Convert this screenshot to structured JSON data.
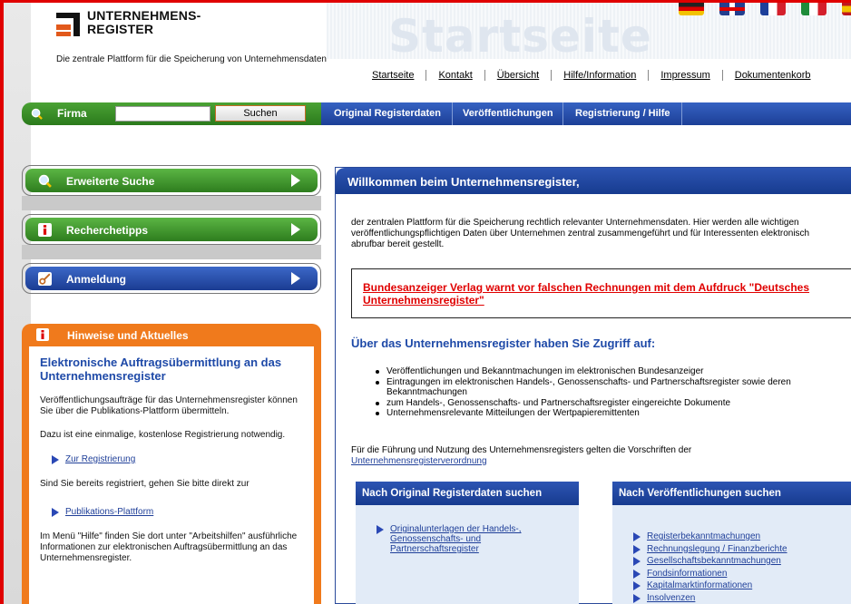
{
  "logo": {
    "line1": "UNTERNEHMENS-",
    "line2": "REGISTER"
  },
  "tagline": "Die zentrale Plattform für die Speicherung von Unternehmensdaten",
  "page_title": "Startseite",
  "top_nav": [
    "Startseite",
    "Kontakt",
    "Übersicht",
    "Hilfe/Information",
    "Impressum",
    "Dokumentenkorb"
  ],
  "search": {
    "label": "Firma",
    "value": "",
    "button": "Suchen"
  },
  "main_nav": [
    "Original Registerdaten",
    "Veröffentlichungen",
    "Registrierung / Hilfe"
  ],
  "sidebar": {
    "items": [
      {
        "label": "Erweiterte Suche"
      },
      {
        "label": "Recherchetipps"
      },
      {
        "label": "Anmeldung"
      }
    ]
  },
  "hinweise": {
    "title": "Hinweise und Aktuelles",
    "heading": "Elektronische Auftragsübermittlung an das Unternehmensregister",
    "p1": "Veröffentlichungsaufträge für das Unternehmensregister können Sie über die Publikations-Plattform übermitteln.",
    "p2": "Dazu ist eine einmalige, kostenlose Registrierung notwendig.",
    "link1": "Zur Registrierung",
    "p3": "Sind Sie bereits registriert, gehen Sie bitte direkt zur",
    "link2": "Publikations-Plattform",
    "p4": "Im Menü \"Hilfe\" finden Sie dort unter \"Arbeitshilfen\" ausführliche Informationen zur elektronischen Auftragsübermittlung an das Unternehmensregister."
  },
  "main": {
    "welcome": "Willkommen beim Unternehmensregister,",
    "intro": "der zentralen Plattform für die Speicherung rechtlich relevanter Unternehmensdaten. Hier werden alle wichtigen veröffentlichungspflichtigen Daten über Unternehmen zentral zusammengeführt und für Interessenten elektronisch abrufbar bereit gestellt.",
    "warning": "Bundesanzeiger Verlag warnt vor falschen Rechnungen mit dem Aufdruck \"Deutsches Unternehmensregister\"",
    "zugriff": "Über das Unternehmensregister haben Sie Zugriff auf:",
    "bullets": [
      "Veröffentlichungen und Bekanntmachungen im elektronischen Bundesanzeiger",
      "Eintragungen im elektronischen Handels-, Genossenschafts- und Partnerschaftsregister sowie deren Bekanntmachungen",
      "zum Handels-, Genossenschafts- und Partnerschaftsregister eingereichte Dokumente",
      "Unternehmensrelevante Mitteilungen der Wertpapieremittenten"
    ],
    "rules_text": "Für die Führung und Nutzung des Unternehmensregisters gelten die Vorschriften der",
    "rules_link": "Unternehmensregisterverordnung"
  },
  "box_original": {
    "title": "Nach Original Registerdaten suchen",
    "links": [
      "Originalunterlagen der Handels-, Genossenschafts- und Partnerschaftsregister"
    ]
  },
  "box_publications": {
    "title": "Nach Veröffentlichungen suchen",
    "links": [
      "Registerbekanntmachungen",
      "Rechnungslegung / Finanzberichte",
      "Gesellschaftsbekanntmachungen",
      "Fondsinformationen",
      "Kapitalmarktinformationen",
      "Insolvenzen"
    ]
  },
  "colors": {
    "green": "#2e7d1e",
    "blue": "#1c3f97",
    "orange": "#f07a1c",
    "red": "#e00000"
  }
}
